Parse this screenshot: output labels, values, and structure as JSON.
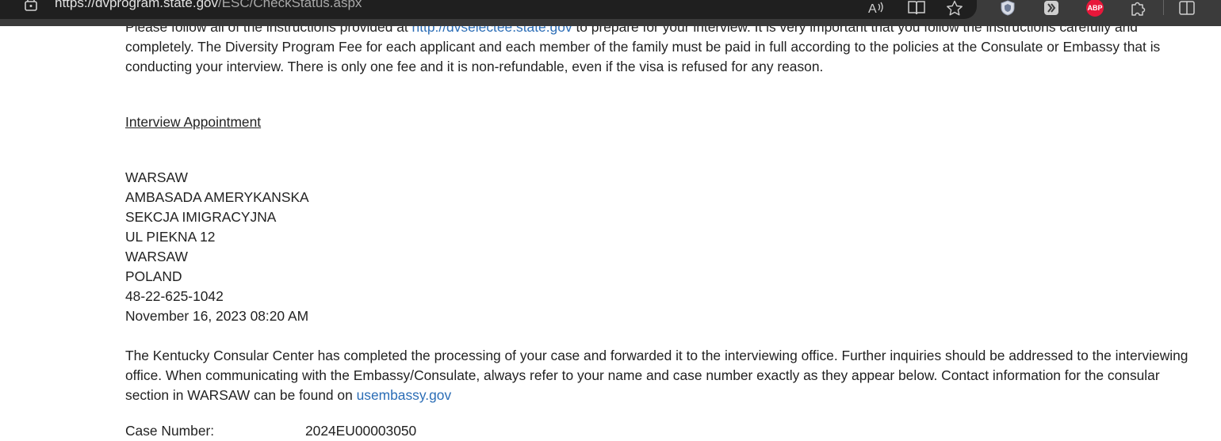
{
  "browser": {
    "url_host": "https://dvprogram.state.gov",
    "url_path": "/ESC/CheckStatus.aspx",
    "toolbar_icons": [
      "read-aloud-icon",
      "immersive-reader-icon",
      "favorite-star-icon",
      "shield-extension-icon",
      "extension-icon",
      "adblock-plus-icon",
      "extensions-puzzle-icon",
      "split-screen-icon"
    ],
    "abp_label": "ABP"
  },
  "page": {
    "intro_part1": "Please follow all of the instructions provided at ",
    "intro_link": "http://dvselectee.state.gov",
    "intro_part2": " to prepare for your interview. It is very important that you follow the instructions carefully and",
    "intro_line2": "completely. The Diversity Program Fee for each applicant and each member of the family must be paid in full according to the policies at the Consulate or Embassy that is",
    "intro_line3": "conducting your interview. There is only one fee and it is non-refundable, even if the visa is refused for any reason.",
    "appointment_heading": "Interview Appointment",
    "address_lines": [
      "WARSAW",
      "AMBASADA AMERYKANSKA",
      "SEKCJA IMIGRACYJNA",
      "UL PIEKNA 12",
      "WARSAW",
      "POLAND",
      "48-22-625-1042",
      "November 16, 2023 08:20 AM"
    ],
    "kcc_line1": "The Kentucky Consular Center has completed the processing of your case and forwarded it to the interviewing office. Further inquiries should be addressed to the interviewing",
    "kcc_line2": "office. When communicating with the Embassy/Consulate, always refer to your name and case number exactly as they appear below. Contact information for the consular",
    "kcc_line3_prefix": "section in WARSAW can be found on ",
    "kcc_link": "usembassy.gov",
    "case_number_label": "Case Number:",
    "case_number_value": "2024EU00003050"
  }
}
